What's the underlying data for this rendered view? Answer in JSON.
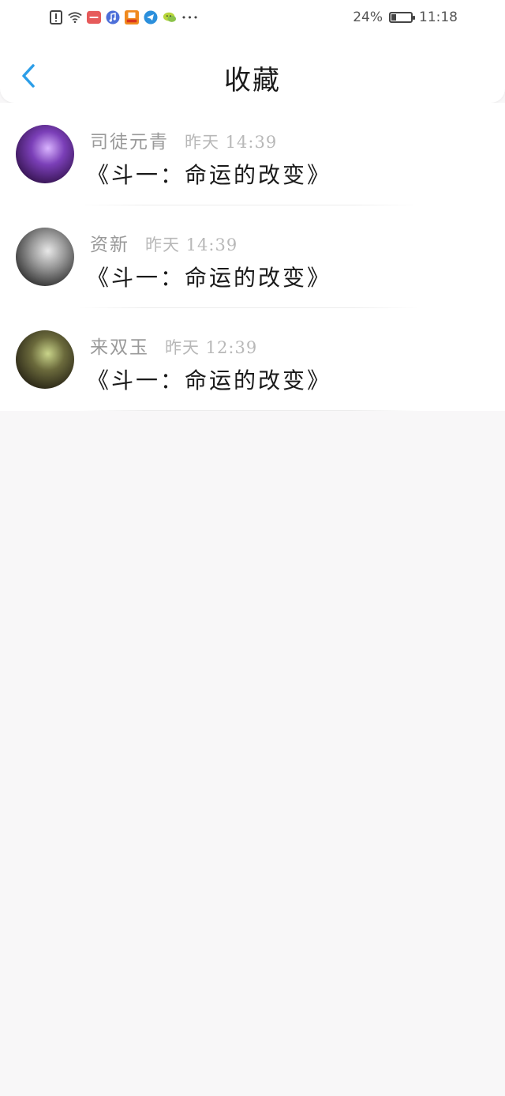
{
  "status_bar": {
    "battery_text": "24%",
    "battery_level": 0.24,
    "time": "11:18",
    "icons": [
      "alert-icon",
      "wifi-icon",
      "app-icon-red",
      "music-icon",
      "app-icon-orange",
      "telegram-icon",
      "wechat-icon",
      "more-icon"
    ],
    "more": "•••"
  },
  "header": {
    "back_icon": "chevron-left-icon",
    "title": "收藏",
    "accent": "#2c9ee8"
  },
  "favorites": [
    {
      "user": "司徒元青",
      "time": "昨天 14:39",
      "title": "《斗一：命运的改变》",
      "avatar_colors": [
        "#2a0d40",
        "#7b3fb8",
        "#d9b4ff"
      ]
    },
    {
      "user": "资新",
      "time": "昨天 14:39",
      "title": "《斗一：命运的改变》",
      "avatar_colors": [
        "#222222",
        "#9a9a9a",
        "#e8e8e8"
      ]
    },
    {
      "user": "来双玉",
      "time": "昨天 12:39",
      "title": "《斗一：命运的改变》",
      "avatar_colors": [
        "#1e1a10",
        "#6b6a3c",
        "#c9d48a"
      ]
    }
  ]
}
